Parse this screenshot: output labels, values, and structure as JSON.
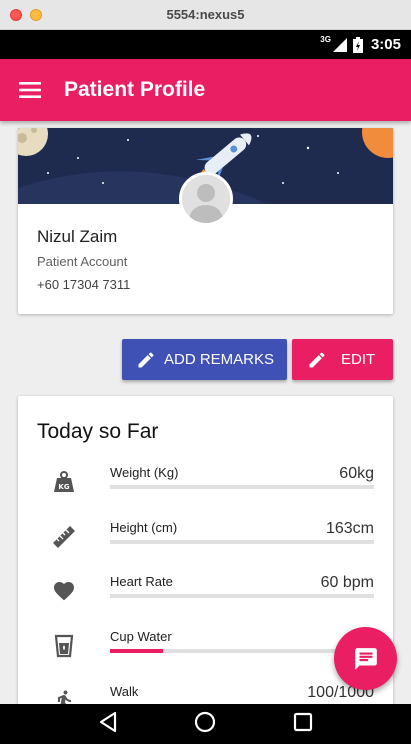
{
  "window": {
    "title": "5554:nexus5"
  },
  "status_bar": {
    "network": "3G",
    "time": "3:05"
  },
  "app_bar": {
    "title": "Patient Profile",
    "menu_icon": "menu-icon"
  },
  "profile": {
    "name": "Nizul Zaim",
    "account_type": "Patient Account",
    "phone": "+60 17304 7311"
  },
  "actions": {
    "add_remarks": "ADD REMARKS",
    "edit": "EDIT"
  },
  "today": {
    "title": "Today so Far",
    "metrics": [
      {
        "icon": "weight-icon",
        "label": "Weight (Kg)",
        "value": "60kg",
        "progress": 0
      },
      {
        "icon": "ruler-icon",
        "label": "Height (cm)",
        "value": "163cm",
        "progress": 0
      },
      {
        "icon": "heart-icon",
        "label": "Heart Rate",
        "value": "60 bpm",
        "progress": 0
      },
      {
        "icon": "cup-water-icon",
        "label": "Cup Water",
        "value": "",
        "progress": 0.2
      },
      {
        "icon": "walk-icon",
        "label": "Walk",
        "value": "100/1000",
        "progress": 0.1
      }
    ]
  },
  "colors": {
    "primary": "#e91e63",
    "indigo": "#3f51b5",
    "banner": "#1f2a4f"
  }
}
